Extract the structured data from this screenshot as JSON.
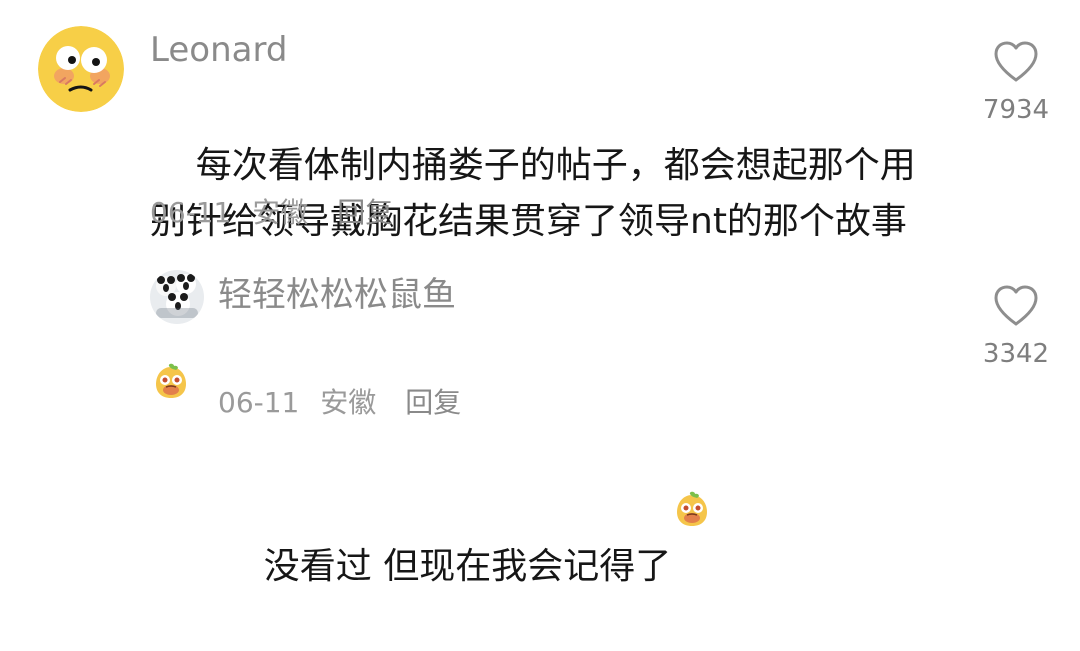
{
  "comments": [
    {
      "username": "Leonard",
      "text": "每次看体制内捅娄子的帖子，都会想起那个用别针给领导戴胸花结果贯穿了领导nt的那个故事",
      "date": "06-11",
      "location": "安徽",
      "reply_label": "回复",
      "like_count": "7934",
      "avatar_icon": "shy-face-avatar",
      "emoji_icon": "cute-lemon-emoji"
    },
    {
      "username": "轻轻松松松鼠鱼",
      "text": "没看过 但现在我会记得了",
      "date": "06-11",
      "location": "安徽",
      "reply_label": "回复",
      "like_count": "3342",
      "avatar_icon": "panda-avatar",
      "emoji_icon": "cute-lemon-emoji"
    }
  ],
  "colors": {
    "username": "#8a8a8a",
    "text": "#161616",
    "meta": "#9a9a9a",
    "like_icon": "#8e8e8e",
    "count": "#7e7e7e",
    "avatar_face": "#f7cf47",
    "emoji_face": "#f5c54a"
  }
}
